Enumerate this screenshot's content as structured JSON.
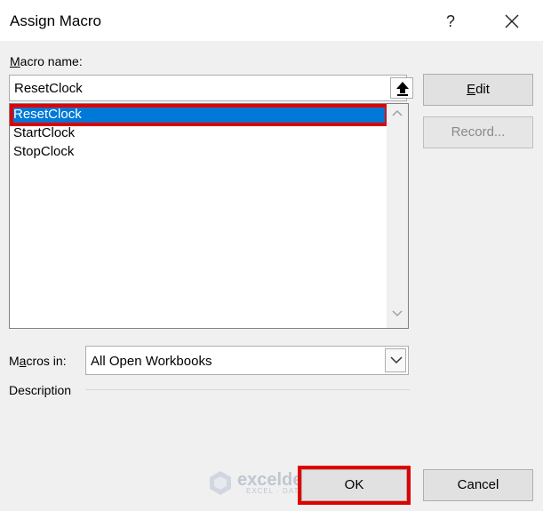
{
  "window": {
    "title": "Assign Macro",
    "help_label": "?",
    "close_icon": "close-icon"
  },
  "macro_name": {
    "label": "Macro name:",
    "label_access_key": "M",
    "label_rest": "acro name:",
    "value": "ResetClock"
  },
  "macro_list": {
    "items": [
      {
        "label": "ResetClock",
        "selected": true
      },
      {
        "label": "StartClock",
        "selected": false
      },
      {
        "label": "StopClock",
        "selected": false
      }
    ]
  },
  "buttons": {
    "edit": {
      "label": "Edit",
      "access_key": "E",
      "rest": "dit"
    },
    "record": {
      "label": "Record...",
      "enabled": false
    },
    "ok": {
      "label": "OK"
    },
    "cancel": {
      "label": "Cancel"
    }
  },
  "macros_in": {
    "label": "Macros in:",
    "label_pre": "M",
    "label_access_key": "a",
    "label_rest": "cros in:",
    "value": "All Open Workbooks"
  },
  "description": {
    "label": "Description"
  },
  "watermark": {
    "brand": "exceldemy",
    "tagline": "EXCEL · DATA · BI"
  },
  "colors": {
    "selection": "#0078d7",
    "annotation_red": "#e00000",
    "dialog_bg": "#f0f0f0"
  }
}
